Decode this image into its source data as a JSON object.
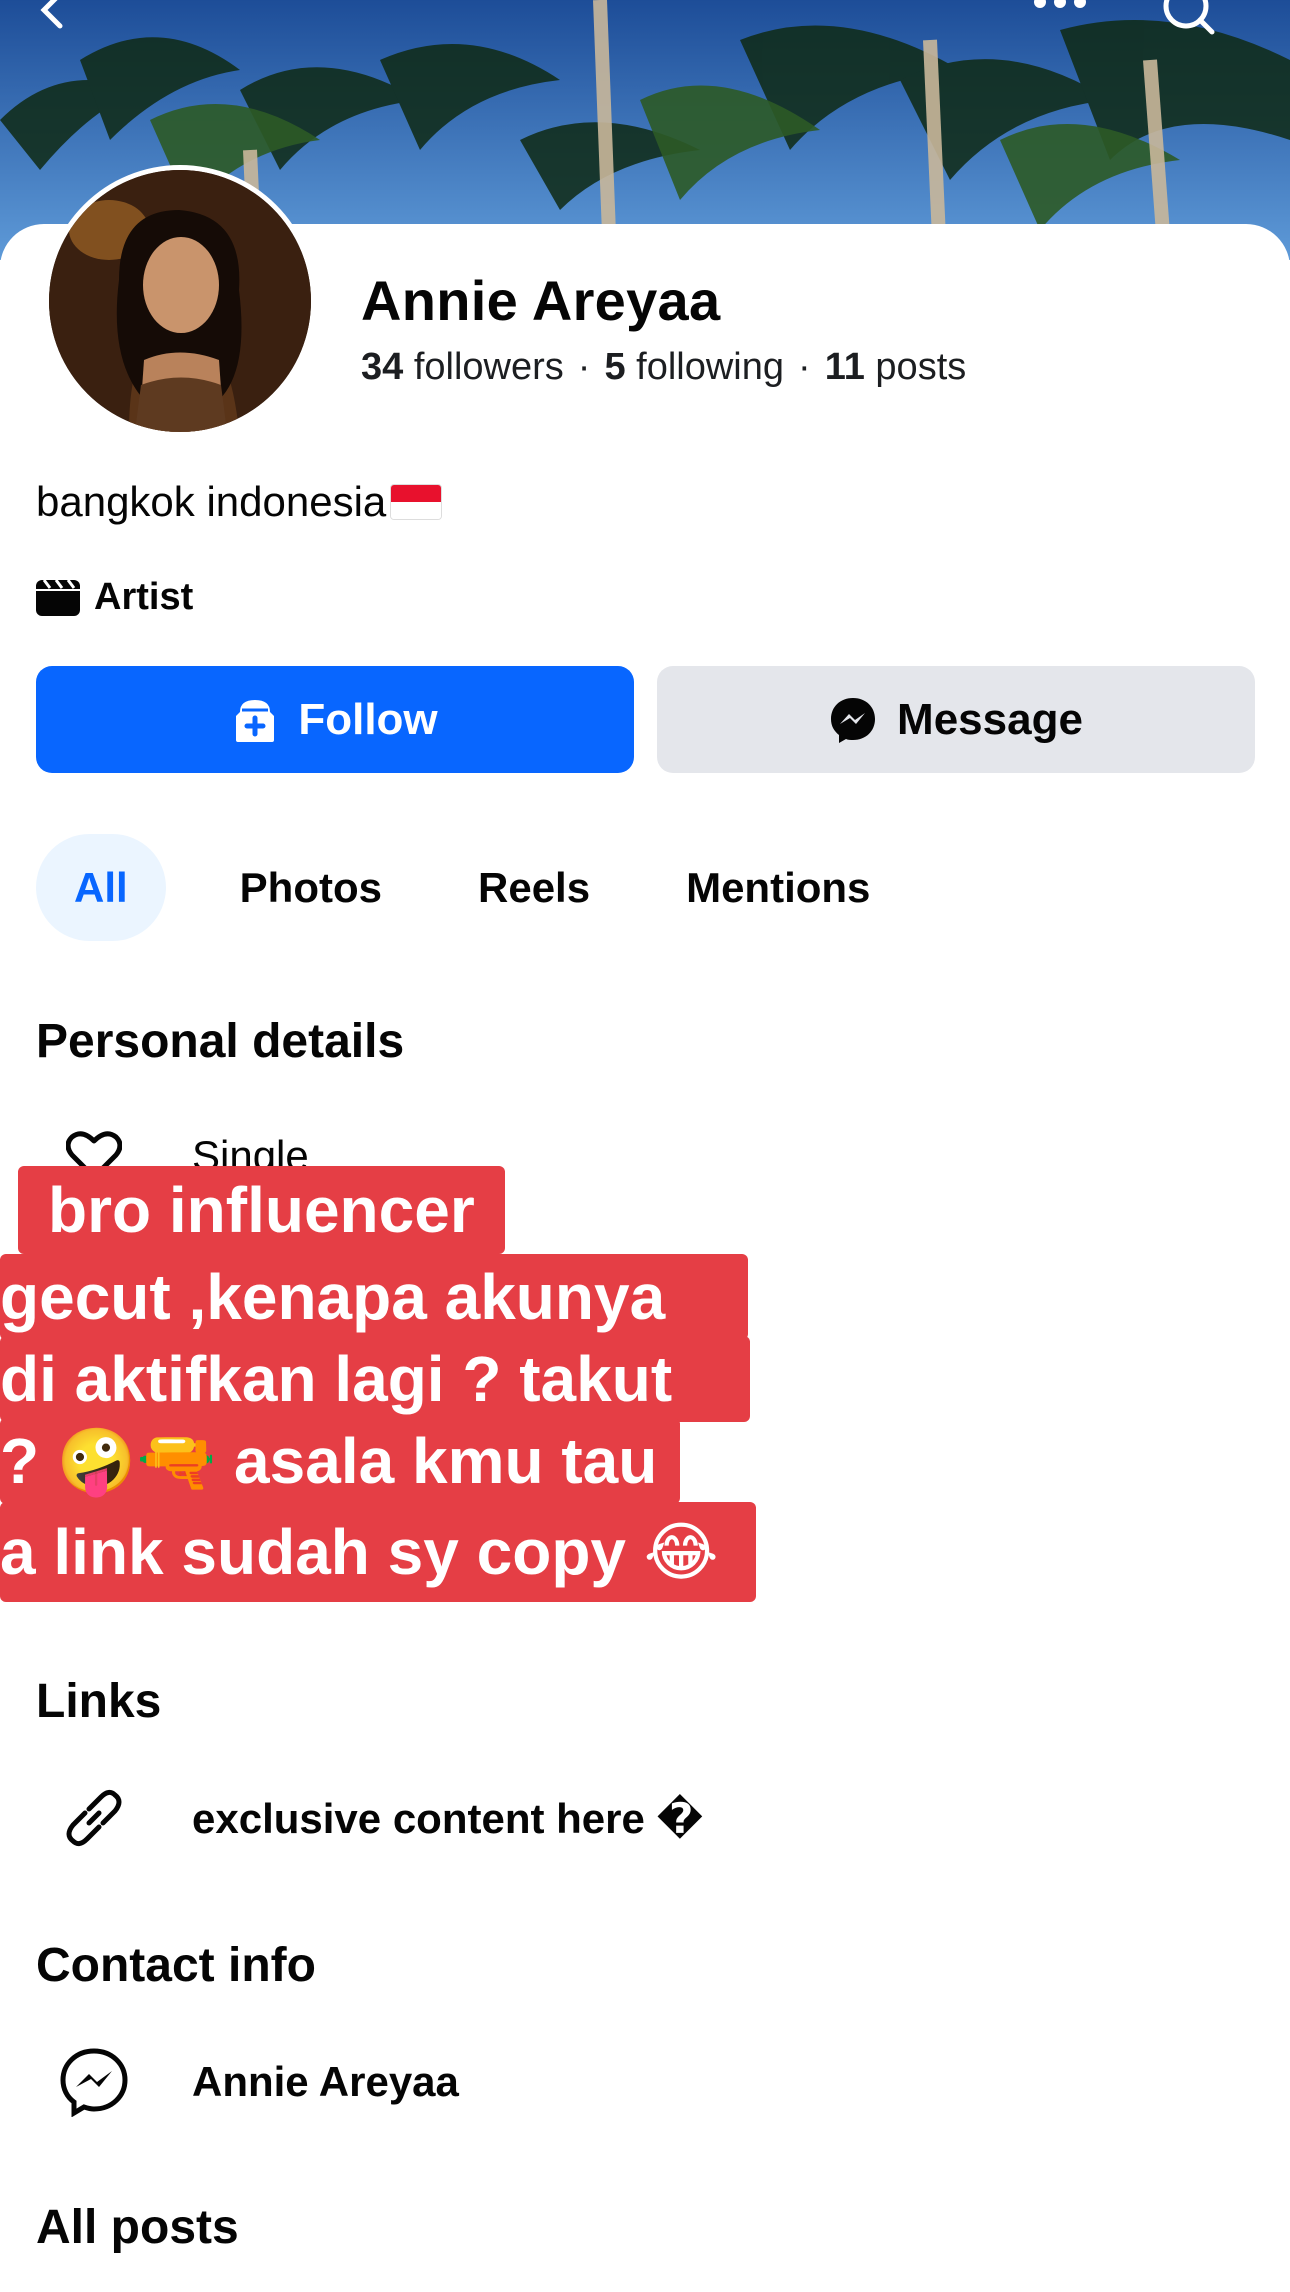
{
  "header": {
    "back_icon": "chevron-left-icon",
    "more_icon": "more-dots-icon",
    "search_icon": "search-icon"
  },
  "profile": {
    "name": "Annie Areyaa",
    "followers_count": "34",
    "followers_label": "followers",
    "following_count": "5",
    "following_label": "following",
    "posts_count": "11",
    "posts_label": "posts",
    "separator": "·",
    "bio": "bangkok indonesia",
    "category": "Artist"
  },
  "actions": {
    "follow_label": "Follow",
    "message_label": "Message"
  },
  "tabs": [
    {
      "label": "All",
      "active": true
    },
    {
      "label": "Photos",
      "active": false
    },
    {
      "label": "Reels",
      "active": false
    },
    {
      "label": "Mentions",
      "active": false
    }
  ],
  "personal_details": {
    "title": "Personal details",
    "relationship": "Single"
  },
  "overlay_caption": {
    "lines": [
      "bro influencer",
      "gecut ,kenapa akunya",
      " di aktifkan lagi ? takut",
      "? 🤪🔫 asala kmu tau",
      "a link sudah sy copy 😂"
    ],
    "color": "#e53e45"
  },
  "links": {
    "title": "Links",
    "item": "exclusive content here �"
  },
  "contact": {
    "title": "Contact info",
    "item": "Annie Areyaa"
  },
  "all_posts": {
    "title": "All posts"
  },
  "colors": {
    "primary": "#0866ff",
    "secondary_button": "#e4e6eb",
    "active_tab_bg": "#ebf5ff"
  }
}
